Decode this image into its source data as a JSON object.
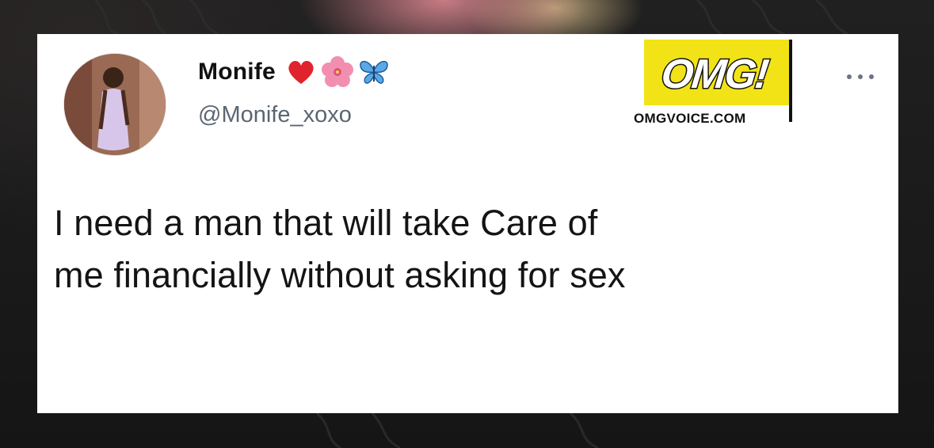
{
  "tweet": {
    "display_name": "Monife",
    "name_emojis": [
      "red-heart-icon",
      "hibiscus-icon",
      "butterfly-icon"
    ],
    "handle": "@Monife_xoxo",
    "text_lines": [
      "I need a man that will take Care of",
      "me financially without asking for sex"
    ],
    "more_label": "..."
  },
  "watermark": {
    "logo_text": "OMG!",
    "site": "OMGVOICE.COM",
    "logo_color": "#f2e316"
  },
  "colors": {
    "card_bg": "#ffffff",
    "text": "#141414",
    "handle": "#5b6672",
    "backdrop": "#1b1b1b"
  }
}
